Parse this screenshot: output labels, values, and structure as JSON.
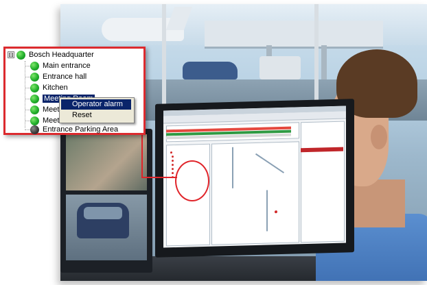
{
  "tree": {
    "root": {
      "label": "Bosch Headquarter",
      "expander": "⊟",
      "status": "ok"
    },
    "children": [
      {
        "label": "Main entrance",
        "status": "ok"
      },
      {
        "label": "Entrance hall",
        "status": "ok"
      },
      {
        "label": "Kitchen",
        "status": "ok"
      },
      {
        "label": "Meeting Room",
        "status": "ok",
        "selected": true
      },
      {
        "label": "Meeti",
        "status": "ok"
      },
      {
        "label": "Meeti",
        "status": "ok"
      },
      {
        "label": "Entrance Parking Area",
        "status": "offline"
      }
    ]
  },
  "context_menu": {
    "items": [
      {
        "label": "Operator alarm",
        "highlighted": true
      },
      {
        "label": "Reset",
        "highlighted": false
      }
    ]
  },
  "colors": {
    "callout_border": "#dc2a2e",
    "status_ok": "#1fae2a",
    "status_offline": "#3c3c3c",
    "selection": "#0a246a"
  }
}
